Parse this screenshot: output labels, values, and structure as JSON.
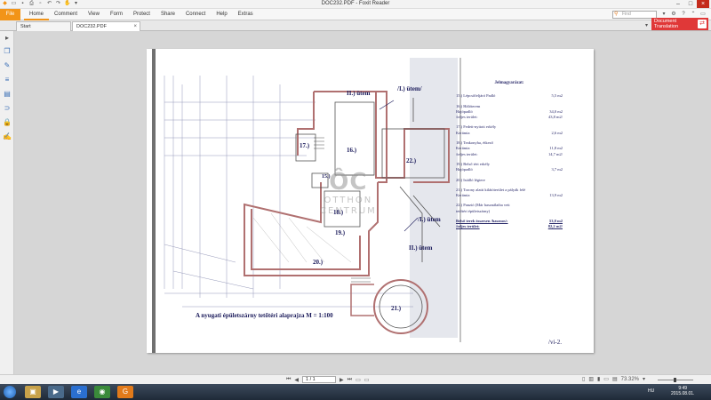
{
  "window": {
    "title": "DOC232.PDF - Foxit Reader"
  },
  "ribbon": {
    "file_label": "File",
    "menu": [
      "Home",
      "Comment",
      "View",
      "Form",
      "Protect",
      "Share",
      "Connect",
      "Help",
      "Extras"
    ],
    "find_placeholder": "Find"
  },
  "tabs": {
    "start": "Start",
    "doc": "DOC232.PDF"
  },
  "doc_translation": {
    "line1": "Document",
    "line2": "Translation"
  },
  "document": {
    "legend_header": "Jelmagyarázat:",
    "legend": [
      {
        "label": "15.) Lépcsőfeljáró  Padló",
        "value": "5,5 m2"
      },
      {
        "label": "16.) Hálóterem",
        "value": ""
      },
      {
        "label": "      Hajópadló",
        "value": "34,0 m2"
      },
      {
        "label": "      /teljes terület:",
        "value": "43,8 m2/"
      },
      {
        "label": "17.) Fedett-nyitott erkély",
        "value": ""
      },
      {
        "label": "      Kerámia",
        "value": "2,6 m2"
      },
      {
        "label": "18.) Teakonyha, étkező",
        "value": ""
      },
      {
        "label": "      Kerámia",
        "value": "11,8 m2"
      },
      {
        "label": "      /teljes terület:",
        "value": "14,7 m2/"
      },
      {
        "label": "19.) Belső téri erkély",
        "value": ""
      },
      {
        "label": "      Hajópadló",
        "value": "3,7 m2"
      },
      {
        "label": "20.) Istálló légtere",
        "value": ""
      },
      {
        "label": "21.) Torony alatti kilátóterület a pályák felé",
        "value": ""
      },
      {
        "label": "      Kerámia",
        "value": "13,9 m2"
      },
      {
        "label": "22.) Panzió   (Már használatba vett",
        "value": ""
      },
      {
        "label": "      tetőtéri épületszárny)",
        "value": ""
      }
    ],
    "sum_label": "Belső terek összesen /hasznos/:",
    "sum_value": "53,0 m2",
    "sum_total_label": "/teljes terület:",
    "sum_total_value": "82,2 m2/",
    "stage_labels": [
      "II.) ütem",
      "/I.) ütem/",
      "/I.) ütem",
      "II.) ütem"
    ],
    "room_labels": [
      "17.)",
      "16.)",
      "22.)",
      "15.)",
      "18.)",
      "19.)",
      "20.)",
      "21.)"
    ],
    "caption": "A nyugati épületszárny tetőtéri alaprajza   M = 1:100",
    "page_number": "/vi-2.",
    "watermark": {
      "logo": "ÔC",
      "line1": "OTTHON",
      "line2": "CENTRUM"
    }
  },
  "status": {
    "page": "1 / 1",
    "zoom": "73.32%"
  },
  "taskbar": {
    "lang": "HU",
    "time": "9:49",
    "date": "2015.08.01."
  },
  "colors": {
    "accent": "#f29418",
    "translate": "#e03838",
    "plan_red": "#b07070",
    "ink": "#1a1a5a"
  }
}
